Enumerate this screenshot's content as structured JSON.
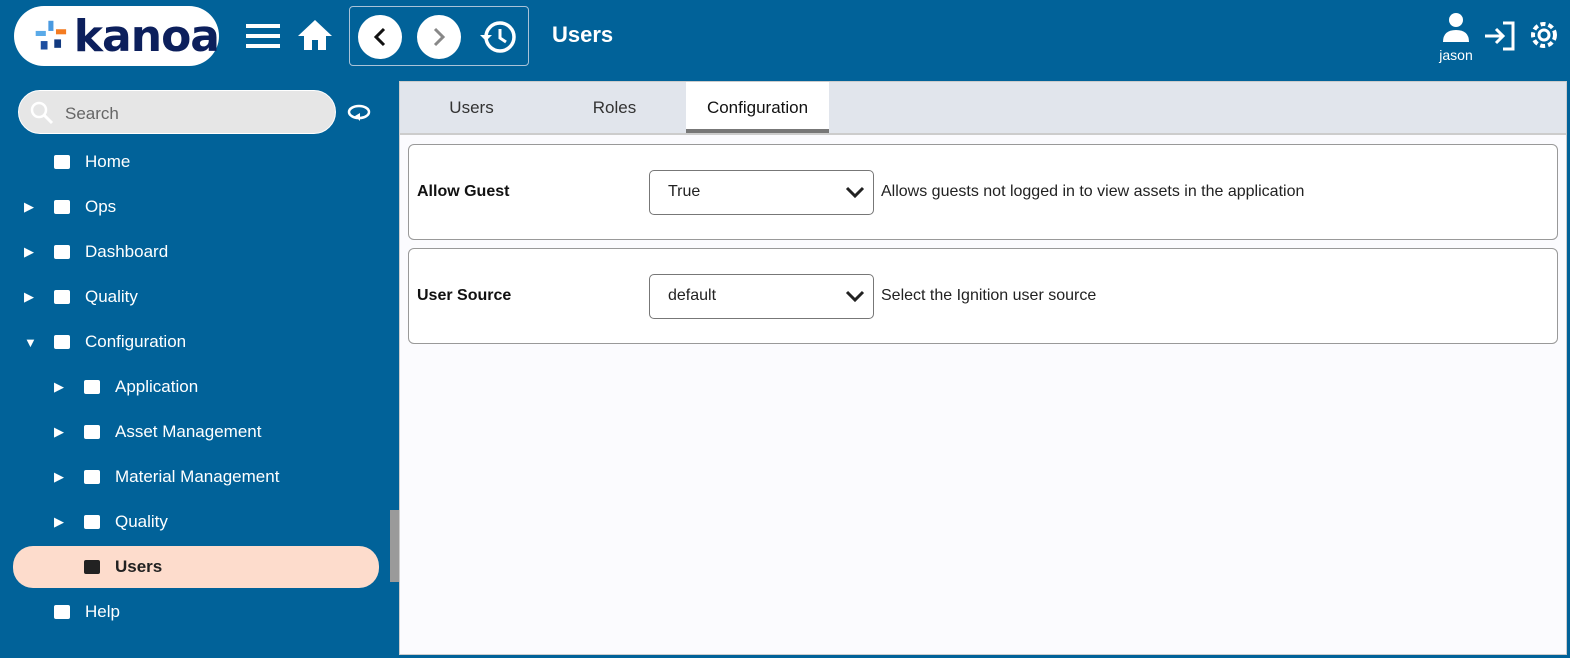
{
  "header": {
    "logo": "kanoa",
    "title": "Users",
    "user": "jason"
  },
  "search": {
    "placeholder": "Search"
  },
  "sidebar": {
    "items": [
      {
        "label": "Home",
        "icon": "home-icon",
        "level": 0,
        "arrow": ""
      },
      {
        "label": "Ops",
        "icon": "conveyor-icon",
        "level": 0,
        "arrow": "▶"
      },
      {
        "label": "Dashboard",
        "icon": "dashboard-icon",
        "level": 0,
        "arrow": "▶"
      },
      {
        "label": "Quality",
        "icon": "checklist-icon",
        "level": 0,
        "arrow": "▶"
      },
      {
        "label": "Configuration",
        "icon": "tools-icon",
        "level": 0,
        "arrow": "▼"
      },
      {
        "label": "Application",
        "icon": "window-icon",
        "level": 1,
        "arrow": "▶"
      },
      {
        "label": "Asset Management",
        "icon": "folder-icon",
        "level": 1,
        "arrow": "▶"
      },
      {
        "label": "Material Management",
        "icon": "folder-icon",
        "level": 1,
        "arrow": "▶"
      },
      {
        "label": "Quality",
        "icon": "checklist-icon",
        "level": 1,
        "arrow": "▶"
      },
      {
        "label": "Users",
        "icon": "users-icon",
        "level": 1,
        "arrow": "",
        "active": true
      },
      {
        "label": "Help",
        "icon": "help-icon",
        "level": 0,
        "arrow": ""
      }
    ]
  },
  "tabs": [
    {
      "label": "Users"
    },
    {
      "label": "Roles"
    },
    {
      "label": "Configuration",
      "selected": true
    }
  ],
  "config": [
    {
      "key": "Allow Guest",
      "value": "True",
      "description": "Allows guests not logged in to view assets in the application"
    },
    {
      "key": "User Source",
      "value": "default",
      "description": "Select the Ignition user source"
    }
  ]
}
